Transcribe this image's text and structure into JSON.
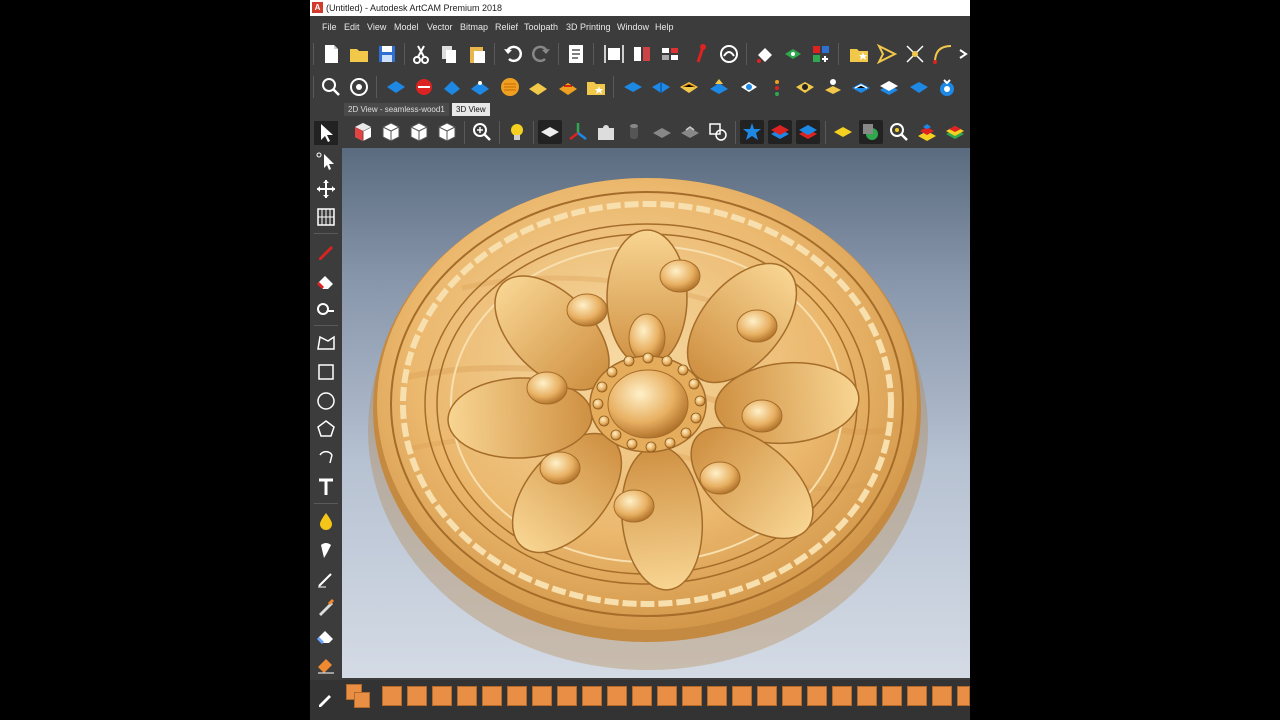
{
  "window": {
    "title": "(Untitled) - Autodesk ArtCAM Premium 2018",
    "app_icon_letter": "A"
  },
  "menu": [
    "File",
    "Edit",
    "View",
    "Model",
    "Vector",
    "Bitmap",
    "Relief",
    "Toolpath",
    "3D Printing",
    "Window",
    "Help"
  ],
  "tabs": {
    "view_2d": "2D View - seamless-wood1",
    "view_3d": "3D View",
    "active": "3D View"
  },
  "toolbar_row1_icons": [
    "new-file-icon",
    "open-folder-icon",
    "save-icon",
    "cut-icon",
    "copy-icon",
    "paste-icon",
    "undo-icon",
    "redo-icon",
    "notes-icon",
    "document-size-icon",
    "mirror-icon",
    "split-icon",
    "pen-icon",
    "curve-icon",
    "paint-bucket-icon",
    "node-icon",
    "color-grid-icon",
    "folder-star-icon",
    "arrow-right-icon",
    "snap-icon",
    "arc-icon",
    "expand-icon"
  ],
  "toolbar_row2_icons": [
    "zoom-fit-icon",
    "relief-icon",
    "shape-editor-icon",
    "sphere-icon",
    "extrude-icon",
    "spin-icon",
    "texture-icon",
    "smooth-icon",
    "fill-icon",
    "folder-relief-icon",
    "blue-plane-icon",
    "two-rail-icon",
    "weave-icon",
    "emboss-icon",
    "bevel-icon",
    "sculpt-icon",
    "add-relief-icon",
    "zero-icon",
    "slice-icon",
    "layers-icon",
    "flat-icon",
    "stamp-icon"
  ],
  "view_toolbar_icons": [
    "iso-view-1-icon",
    "iso-view-2-icon",
    "iso-view-3-icon",
    "iso-view-4-icon",
    "zoom-icon",
    "light-bulb-icon",
    "flat-plane-icon",
    "axes-icon",
    "puzzle-icon",
    "cylinder-icon",
    "grey-relief-icon",
    "grey-box-icon",
    "copy-view-icon",
    "blue-star-icon",
    "blue-layer-icon",
    "red-blue-layer-icon",
    "yellow-diamond-icon",
    "green-shape-icon",
    "zoom-select-icon",
    "stack-colors-icon",
    "rainbow-icon"
  ],
  "left_tools": [
    "select-arrow-icon",
    "node-select-icon",
    "transform-icon",
    "grid-icon",
    "pencil-icon",
    "eraser-fill-icon",
    "measure-icon",
    "polyline-icon",
    "rectangle-icon",
    "circle-icon",
    "polygon-icon",
    "arc-tool-icon",
    "text-icon",
    "drop-icon",
    "brush-icon",
    "pen-tool-icon",
    "knife-icon",
    "eraser-icon",
    "paint-icon",
    "color-picker-icon"
  ],
  "colors": {
    "ui_bg": "#3c3c3c",
    "swatch": "#e98f45",
    "wood_light": "#f0c683",
    "wood_dark": "#c98a3b",
    "viewport_top": "#5a6b80",
    "viewport_bottom": "#d4dbe5"
  },
  "swatch_count": 24
}
